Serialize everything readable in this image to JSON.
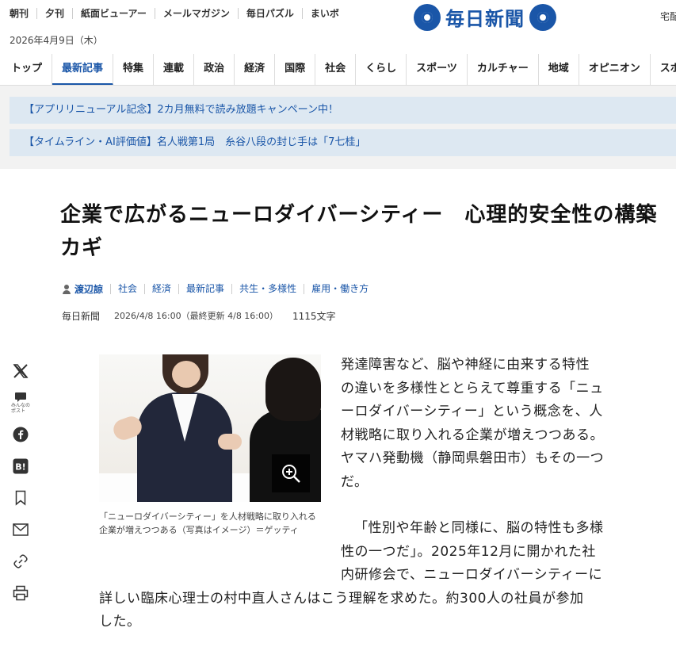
{
  "header": {
    "util_nav": [
      "朝刊",
      "夕刊",
      "紙面ビューアー",
      "メールマガジン",
      "毎日パズル",
      "まいボ"
    ],
    "date": "2026年4月9日（木）",
    "logo_text": "毎日新聞",
    "home_delivery": "宅配"
  },
  "main_nav": {
    "items": [
      "トップ",
      "最新記事",
      "特集",
      "連載",
      "政治",
      "経済",
      "国際",
      "社会",
      "くらし",
      "スポーツ",
      "カルチャー",
      "地域",
      "オピニオン",
      "スポ"
    ],
    "active": "最新記事"
  },
  "banners": [
    "【アプリリニューアル記念】2カ月無料で読み放題キャンペーン中！",
    "【タイムライン・AI評価値】名人戦第1局　糸谷八段の封じ手は「7七桂」"
  ],
  "article": {
    "title": "企業で広がるニューロダイバーシティー　心理的安全性の構築カギ",
    "author": "渡辺諒",
    "tags": [
      "社会",
      "経済",
      "最新記事",
      "共生・多様性",
      "雇用・働き方"
    ],
    "publisher": "毎日新聞",
    "timestamp": "2026/4/8 16:00（最終更新 4/8 16:00）",
    "char_count": "1115文字",
    "caption": "「ニューロダイバーシティー」を人材戦略に取り入れる企業が増えつつある（写真はイメージ）＝ゲッティ",
    "para1_lines": [
      "発達障害など、脳や神経に由来する特性",
      "の違いを多様性ととらえて尊重する「ニュ",
      "ーロダイバーシティー」という概念を、人",
      "材戦略に取り入れる企業が増えつつある。",
      "ヤマハ発動機（静岡県磐田市）もその一つ",
      "だ。"
    ],
    "para2_lines": [
      "「性別や年齢と同様に、脳の特性も多様",
      "性の一つだ」。2025年12月に開かれた社",
      "内研修会で、ニューロダイバーシティーに",
      "詳しい臨床心理士の村中直人さんはこう理解を求めた。約300人の社員が参加",
      "した。"
    ]
  },
  "share": {
    "minna_label": "みんなの\nポスト",
    "items": [
      "x-icon",
      "minna-no-post-icon",
      "facebook-icon",
      "hatena-bookmark-icon",
      "bookmark-icon",
      "mail-icon",
      "link-icon",
      "print-icon"
    ]
  },
  "colors": {
    "brand": "#1a56a8",
    "banner_bg": "#dde8f2"
  }
}
